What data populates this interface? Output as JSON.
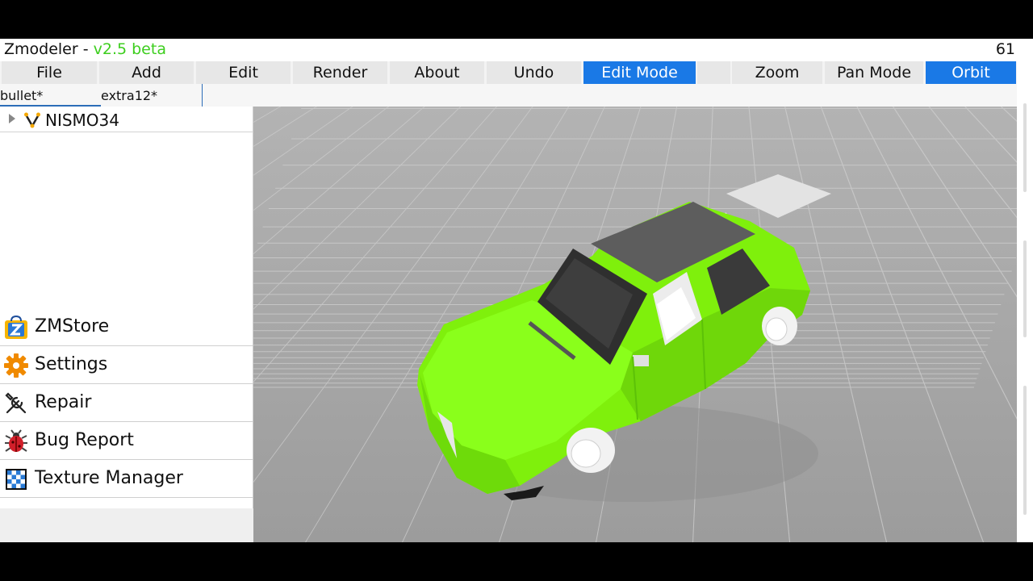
{
  "title": {
    "app": "Zmodeler",
    "separator": " - ",
    "version": "v2.5 beta",
    "fps": "61"
  },
  "menu": {
    "file": "File",
    "add": "Add",
    "edit": "Edit",
    "render": "Render",
    "about": "About",
    "undo": "Undo",
    "edit_mode": "Edit Mode",
    "zoom": "Zoom",
    "pan_mode": "Pan Mode",
    "orbit": "Orbit"
  },
  "tabs": [
    "bullet*",
    "extra12*"
  ],
  "tree": {
    "root": "NISMO34"
  },
  "sidebar": [
    {
      "label": "ZMStore",
      "icon": "zmstore-icon"
    },
    {
      "label": "Settings",
      "icon": "gear-icon"
    },
    {
      "label": "Repair",
      "icon": "wrench-screwdriver-icon"
    },
    {
      "label": "Bug Report",
      "icon": "bug-icon"
    },
    {
      "label": "Texture Manager",
      "icon": "checker-texture-icon"
    }
  ],
  "viewport": {
    "model": "car-model",
    "car_color": "#7ff00c"
  },
  "colors": {
    "accent": "#1a79e6",
    "version": "#3dce1e"
  }
}
